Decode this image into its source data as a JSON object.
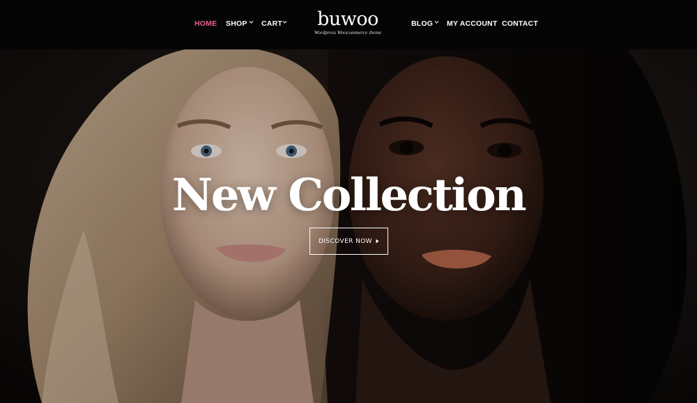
{
  "nav": {
    "left": [
      {
        "label": "HOME",
        "active": true
      },
      {
        "label": "SHOP",
        "has_dropdown": true
      },
      {
        "label": "CART",
        "has_dropdown": true
      }
    ],
    "right": [
      {
        "label": "BLOG",
        "has_dropdown": true
      },
      {
        "label": "MY ACCOUNT"
      },
      {
        "label": "CONTACT"
      }
    ]
  },
  "logo": {
    "name": "buwoo",
    "tagline": "Wordpress Woocommerce theme"
  },
  "hero": {
    "title": "New Collection",
    "button_label": "DISCOVER NOW",
    "button_icon": "caret-right-icon"
  },
  "colors": {
    "accent": "#e8628f",
    "header_bg": "#050505",
    "text": "#ffffff"
  }
}
